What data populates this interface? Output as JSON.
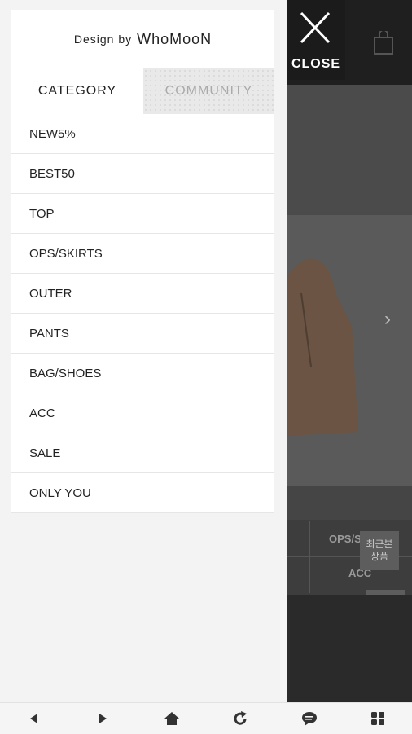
{
  "drawer": {
    "brand_prefix": "Design by",
    "brand_name": "WhoMooN",
    "tabs": [
      {
        "label": "CATEGORY",
        "active": true
      },
      {
        "label": "COMMUNITY",
        "active": false
      }
    ],
    "categories": [
      "NEW5%",
      "BEST50",
      "TOP",
      "OPS/SKIRTS",
      "OUTER",
      "PANTS",
      "BAG/SHOES",
      "ACC",
      "SALE",
      "ONLY YOU"
    ]
  },
  "close_button": {
    "label": "CLOSE",
    "icon": "close-icon"
  },
  "background": {
    "category_grid": [
      "OPS/Skirts",
      "ACC"
    ],
    "recent_label": "최근본\n상품",
    "icons": [
      "shopping-bag-icon",
      "chevron-right-icon",
      "scroll-up-icon",
      "scroll-down-icon"
    ]
  },
  "bottom_nav": {
    "icons": [
      "back-icon",
      "forward-icon",
      "home-icon",
      "refresh-icon",
      "chat-icon",
      "apps-icon"
    ]
  }
}
